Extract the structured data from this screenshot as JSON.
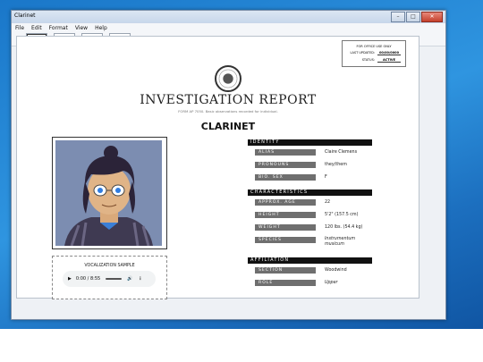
{
  "window": {
    "title": "Clarinet"
  },
  "menu": [
    "File",
    "Edit",
    "Format",
    "View",
    "Help"
  ],
  "toolbar": {
    "icons": [
      "id-card-icon",
      "eye-icon",
      "speech-bubble-icon",
      "pen-icon"
    ]
  },
  "office": {
    "header": "FOR OFFICE USE ONLY",
    "last_updated_label": "LAST UPDATED:",
    "last_updated_value": "00/00/0000",
    "status_label": "STATUS:",
    "status_value": "ACTIVE"
  },
  "report": {
    "title": "INVESTIGATION REPORT",
    "form_note": "FORM AP 7050. Basic observations recorded for individual.",
    "subject": "CLARINET"
  },
  "audio": {
    "label": "VOCALIZATION SAMPLE",
    "time": "0:00 / 8:55",
    "progress": 0
  },
  "sections": {
    "identity": {
      "title": "IDENTITY",
      "fields": [
        {
          "label": "ALIAS",
          "value": "Claire Clemens"
        },
        {
          "label": "PRONOUNS",
          "value": "they/them"
        },
        {
          "label": "BIO. SEX",
          "value": "F"
        }
      ]
    },
    "characteristics": {
      "title": "CHARACTERISTICS",
      "fields": [
        {
          "label": "APPROX. AGE",
          "value": "22"
        },
        {
          "label": "HEIGHT",
          "value": "5'2\" (157.5 cm)"
        },
        {
          "label": "WEIGHT",
          "value": "120 lbs. (54.4 kg)"
        },
        {
          "label": "SPECIES",
          "value": "Instrumentum musicum"
        }
      ]
    },
    "affiliation": {
      "title": "AFFILIATION",
      "fields": [
        {
          "label": "SECTION",
          "value": "Woodwind"
        },
        {
          "label": "ROLE",
          "value": "Upper"
        }
      ]
    }
  }
}
